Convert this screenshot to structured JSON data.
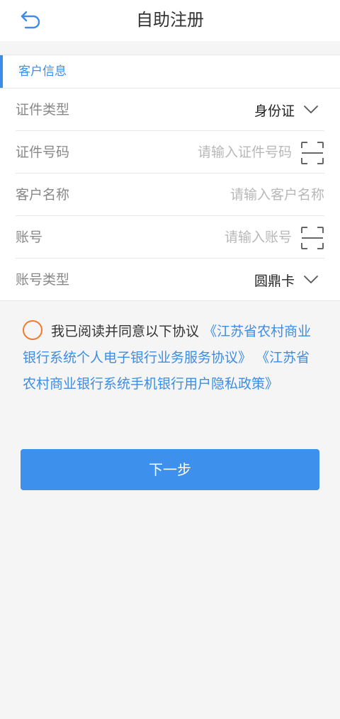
{
  "header": {
    "title": "自助注册",
    "back_icon": "back-arrow-icon"
  },
  "section": {
    "title": "客户信息",
    "accent_color": "#3b8de6"
  },
  "form": {
    "id_type": {
      "label": "证件类型",
      "value": "身份证"
    },
    "id_number": {
      "label": "证件号码",
      "placeholder": "请输入证件号码"
    },
    "customer_name": {
      "label": "客户名称",
      "placeholder": "请输入客户名称"
    },
    "account": {
      "label": "账号",
      "placeholder": "请输入账号"
    },
    "account_type": {
      "label": "账号类型",
      "value": "圆鼎卡"
    }
  },
  "agreement": {
    "prefix": "我已阅读并同意以下协议",
    "link1": "《江苏省农村商业银行系统个人电子银行业务服务协议》",
    "link2": "《江苏省农村商业银行系统手机银行用户隐私政策》",
    "checked": false,
    "radio_color": "#f27a2c"
  },
  "next_button": {
    "label": "下一步",
    "color": "#3d90ec"
  }
}
